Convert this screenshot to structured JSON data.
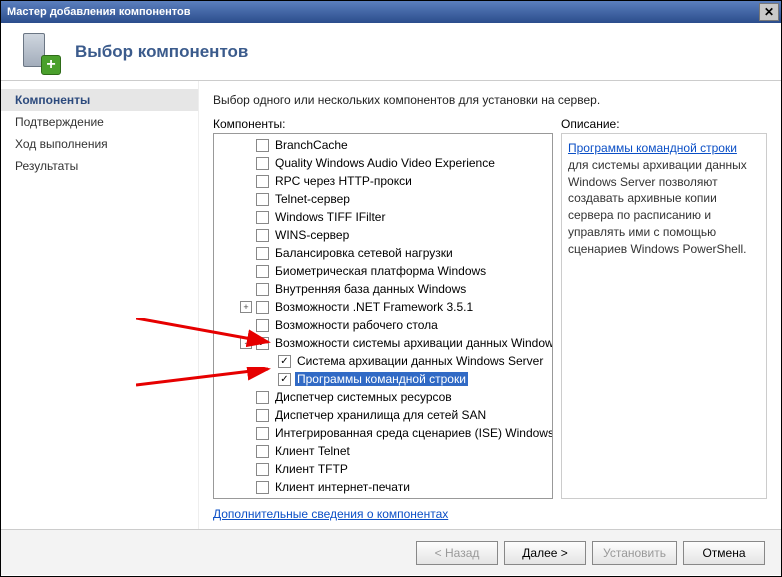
{
  "window": {
    "title": "Мастер добавления компонентов"
  },
  "header": {
    "title": "Выбор компонентов"
  },
  "sidebar": {
    "items": [
      {
        "label": "Компоненты",
        "active": true
      },
      {
        "label": "Подтверждение",
        "active": false
      },
      {
        "label": "Ход выполнения",
        "active": false
      },
      {
        "label": "Результаты",
        "active": false
      }
    ]
  },
  "content": {
    "instruction": "Выбор одного или нескольких компонентов для установки на сервер.",
    "components_label": "Компоненты:",
    "description_label": "Описание:",
    "more_link": "Дополнительные сведения о компонентах",
    "tree": [
      {
        "indent": 1,
        "expander": "",
        "checked": false,
        "label": "BranchCache"
      },
      {
        "indent": 1,
        "expander": "",
        "checked": false,
        "label": "Quality Windows Audio Video Experience"
      },
      {
        "indent": 1,
        "expander": "",
        "checked": false,
        "label": "RPC через HTTP-прокси"
      },
      {
        "indent": 1,
        "expander": "",
        "checked": false,
        "label": "Telnet-сервер"
      },
      {
        "indent": 1,
        "expander": "",
        "checked": false,
        "label": "Windows TIFF IFilter"
      },
      {
        "indent": 1,
        "expander": "",
        "checked": false,
        "label": "WINS-сервер"
      },
      {
        "indent": 1,
        "expander": "",
        "checked": false,
        "label": "Балансировка сетевой нагрузки"
      },
      {
        "indent": 1,
        "expander": "",
        "checked": false,
        "label": "Биометрическая платформа Windows"
      },
      {
        "indent": 1,
        "expander": "",
        "checked": false,
        "label": "Внутренняя база данных Windows"
      },
      {
        "indent": 1,
        "expander": "+",
        "checked": false,
        "label": "Возможности .NET Framework 3.5.1"
      },
      {
        "indent": 1,
        "expander": "",
        "checked": false,
        "label": "Возможности рабочего стола"
      },
      {
        "indent": 1,
        "expander": "-",
        "checked": true,
        "label": "Возможности системы архивации данных Windows Server"
      },
      {
        "indent": 2,
        "expander": "",
        "checked": true,
        "label": "Система архивации данных Windows Server"
      },
      {
        "indent": 2,
        "expander": "",
        "checked": true,
        "label": "Программы командной строки",
        "selected": true
      },
      {
        "indent": 1,
        "expander": "",
        "checked": false,
        "label": "Диспетчер системных ресурсов"
      },
      {
        "indent": 1,
        "expander": "",
        "checked": false,
        "label": "Диспетчер хранилища для сетей SAN"
      },
      {
        "indent": 1,
        "expander": "",
        "checked": false,
        "label": "Интегрированная среда сценариев (ISE) Windows PowerShell"
      },
      {
        "indent": 1,
        "expander": "",
        "checked": false,
        "label": "Клиент Telnet"
      },
      {
        "indent": 1,
        "expander": "",
        "checked": false,
        "label": "Клиент TFTP"
      },
      {
        "indent": 1,
        "expander": "",
        "checked": false,
        "label": "Клиент интернет-печати"
      }
    ],
    "description": {
      "link_text": "Программы командной строки",
      "text_after": " для системы архивации данных Windows Server позволяют создавать архивные копии сервера по расписанию и управлять ими с помощью сценариев Windows PowerShell."
    }
  },
  "footer": {
    "back": "< Назад",
    "next": "Далее >",
    "install": "Установить",
    "cancel": "Отмена"
  }
}
